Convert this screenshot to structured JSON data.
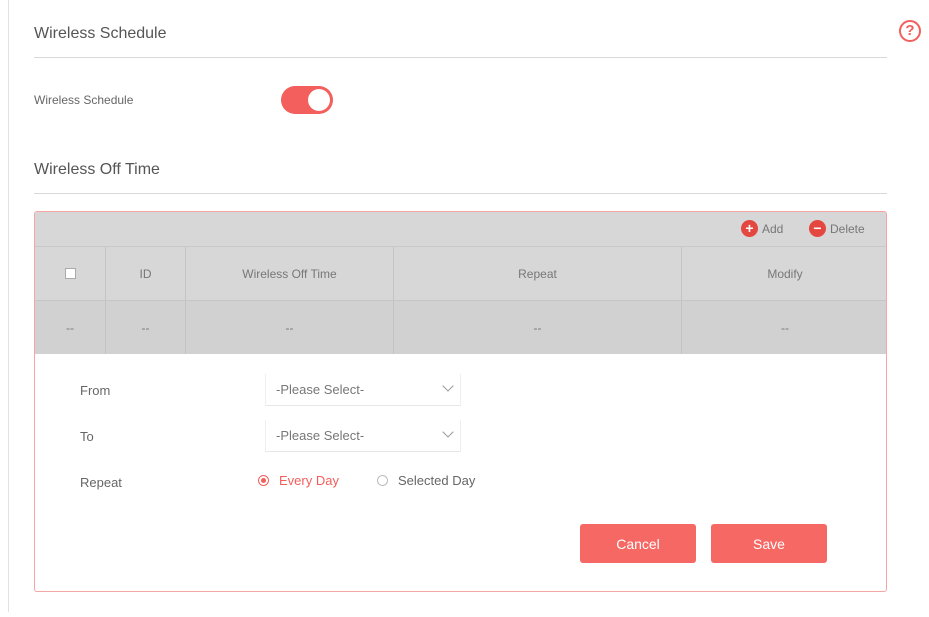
{
  "help": {
    "icon": "question-icon",
    "glyph": "?"
  },
  "schedule_section": {
    "title": "Wireless Schedule",
    "toggle_label": "Wireless Schedule",
    "toggle_on": true
  },
  "off_time_section": {
    "title": "Wireless Off Time"
  },
  "toolbar": {
    "add_label": "Add",
    "delete_label": "Delete",
    "add_icon": "plus-icon",
    "delete_icon": "minus-icon",
    "add_glyph": "+",
    "delete_glyph": "−"
  },
  "table": {
    "headers": [
      "",
      "ID",
      "Wireless Off Time",
      "Repeat",
      "Modify"
    ],
    "row": [
      "--",
      "--",
      "--",
      "--",
      "--"
    ]
  },
  "form": {
    "from_label": "From",
    "from_value": "-Please Select-",
    "to_label": "To",
    "to_value": "-Please Select-",
    "repeat_label": "Repeat",
    "repeat_options": [
      "Every Day",
      "Selected Day"
    ],
    "repeat_selected": "Every Day"
  },
  "buttons": {
    "cancel": "Cancel",
    "save": "Save"
  },
  "colors": {
    "accent": "#f25f5c",
    "button": "#f66864",
    "table_header": "#d7d7d7"
  }
}
